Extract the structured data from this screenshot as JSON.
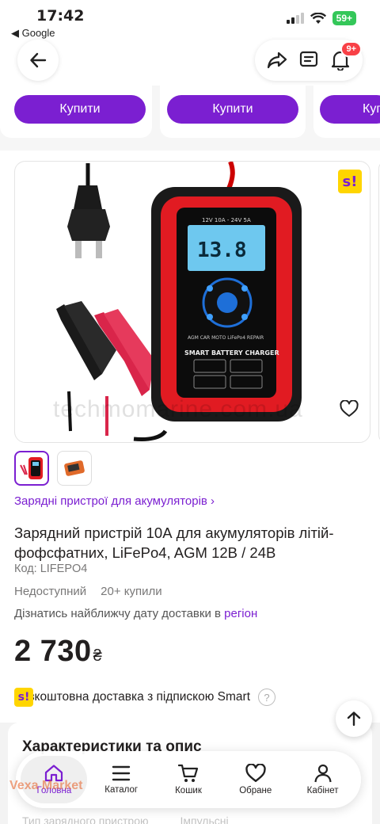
{
  "status_bar": {
    "time": "17:42",
    "back_app": "◀ Google",
    "battery": "59+"
  },
  "header": {
    "notifications_badge": "9+"
  },
  "buy_strip": {
    "buttons": [
      "Купити",
      "Купити",
      "Куп"
    ]
  },
  "gallery": {
    "watermark": "techmomarine.com.ua",
    "smart_badge": "s!",
    "device_labels": {
      "top": "12V 10A - 24V 5A",
      "display": "13.8",
      "brand": "SMART BATTERY CHARGER",
      "modes": [
        "AGM",
        "CAR",
        "MOTO",
        "LiFePo4",
        "REPAIR"
      ]
    }
  },
  "product": {
    "breadcrumb": "Зарядні пристрої для акумуляторів ›",
    "title": "Зарядний пристрій 10А для акумуляторів літій-фофсфатних, LiFePo4, AGM 12В / 24В",
    "code": "Код: LIFEPO4",
    "availability": "Недоступний",
    "bought": "20+ купили",
    "delivery_prefix": "Дізнатись найближчу дату доставки в",
    "delivery_link": "регіон",
    "price": "2 730",
    "currency": "₴",
    "smart_text": "Безкоштовна доставка з підпискою Smart",
    "smart_badge": "s!",
    "help_icon": "?"
  },
  "specs": {
    "title": "Характеристики та опис",
    "faded_row": [
      "Тип зарядного пристрою",
      "Імпульсні"
    ]
  },
  "bottom_nav": {
    "items": [
      {
        "label": "Головна",
        "icon": "home-icon"
      },
      {
        "label": "Каталог",
        "icon": "menu-icon"
      },
      {
        "label": "Кошик",
        "icon": "cart-icon"
      },
      {
        "label": "Обране",
        "icon": "heart-icon"
      },
      {
        "label": "Кабінет",
        "icon": "user-icon"
      }
    ],
    "watermark_logo": "Vexa Market"
  },
  "colors": {
    "accent": "#7b1fd1",
    "badge": "#f84147",
    "smart_yellow": "#ffd500"
  }
}
